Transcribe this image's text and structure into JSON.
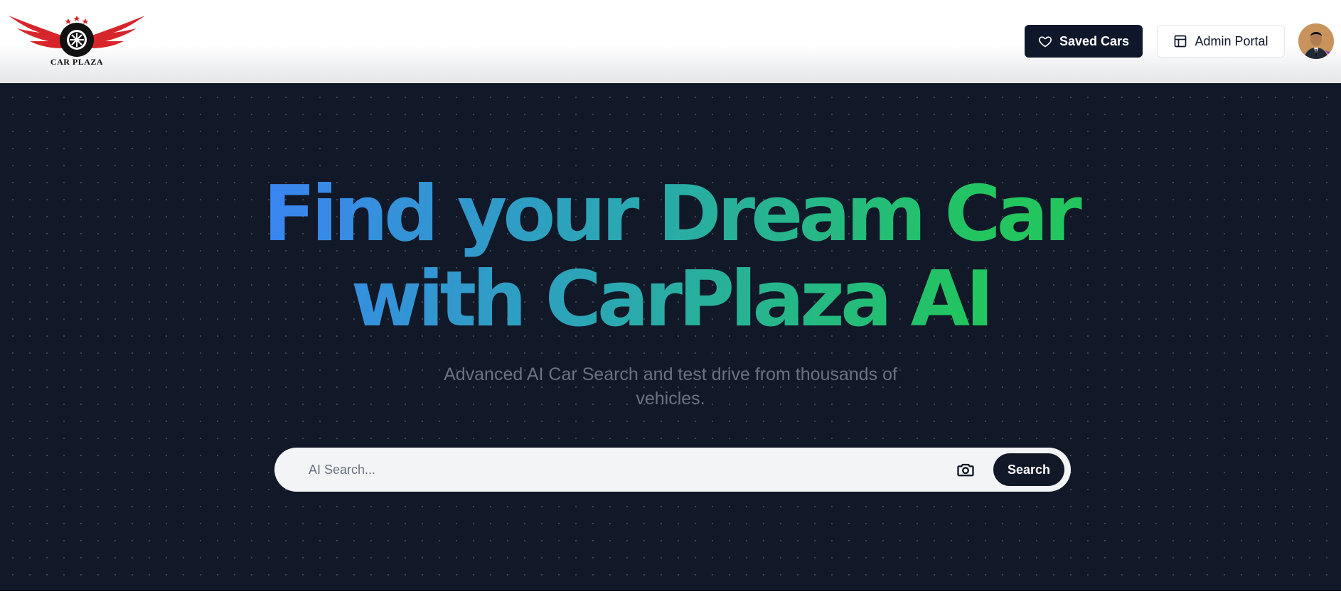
{
  "header": {
    "logo_text": "CAR PLAZA",
    "saved_cars_label": "Saved Cars",
    "admin_portal_label": "Admin Portal",
    "icons": {
      "saved": "heart-icon",
      "admin": "layout-icon",
      "avatar": "user-avatar"
    }
  },
  "hero": {
    "headline_line1": "Find your Dream Car",
    "headline_line2": "with CarPlaza AI",
    "subtitle": "Advanced AI Car Search and test drive from thousands of vehicles.",
    "search": {
      "placeholder": "AI Search...",
      "value": "",
      "button_label": "Search",
      "camera_icon": "camera-icon"
    }
  },
  "colors": {
    "navy": "#0f172a",
    "hero_bg": "#111827",
    "gradient_start": "#3b82f6",
    "gradient_end": "#22c55e",
    "logo_red": "#d7262b"
  }
}
